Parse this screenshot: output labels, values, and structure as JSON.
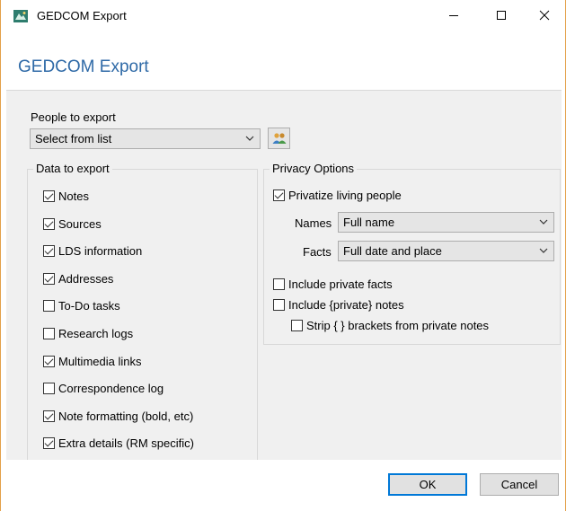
{
  "window": {
    "title": "GEDCOM Export",
    "controls": {
      "minimize": "minimize",
      "maximize": "maximize",
      "close": "close"
    }
  },
  "header": {
    "title": "GEDCOM Export"
  },
  "people": {
    "label": "People to export",
    "selected": "Select from list"
  },
  "data_group": {
    "title": "Data to export",
    "items": [
      {
        "label": "Notes",
        "checked": true
      },
      {
        "label": "Sources",
        "checked": true
      },
      {
        "label": "LDS information",
        "checked": true
      },
      {
        "label": "Addresses",
        "checked": true
      },
      {
        "label": "To-Do tasks",
        "checked": false
      },
      {
        "label": "Research logs",
        "checked": false
      },
      {
        "label": "Multimedia links",
        "checked": true
      },
      {
        "label": "Correspondence log",
        "checked": false
      },
      {
        "label": "Note formatting (bold, etc)",
        "checked": true
      },
      {
        "label": "Extra details (RM specific)",
        "checked": true
      }
    ]
  },
  "privacy": {
    "title": "Privacy Options",
    "privatize": {
      "label": "Privatize living people",
      "checked": true
    },
    "names": {
      "label": "Names",
      "selected": "Full name"
    },
    "facts": {
      "label": "Facts",
      "selected": "Full date and place"
    },
    "include_private_facts": {
      "label": "Include private facts",
      "checked": false
    },
    "include_private_notes": {
      "label": "Include {private} notes",
      "checked": false
    },
    "strip_brackets": {
      "label": "Strip { } brackets from private notes",
      "checked": false
    }
  },
  "buttons": {
    "ok": "OK",
    "cancel": "Cancel"
  },
  "colors": {
    "header_title": "#2f6aa7",
    "default_button_border": "#0078d7",
    "panel_bg": "#f0f0f0"
  }
}
